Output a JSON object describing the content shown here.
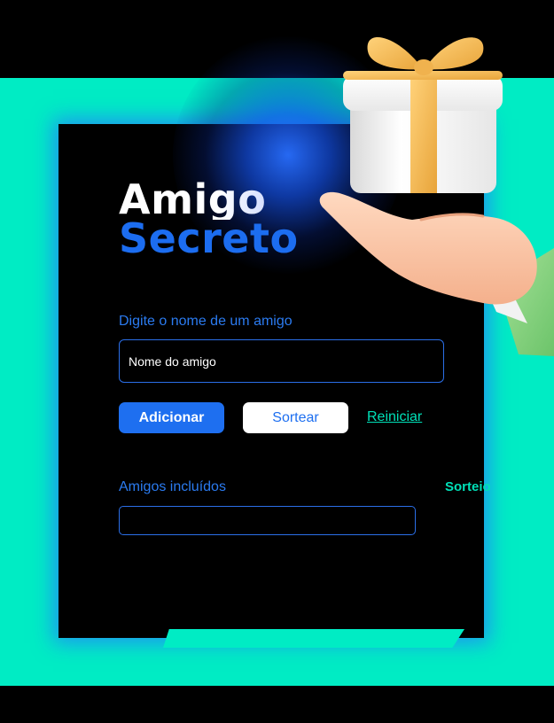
{
  "header": {
    "title_line1": "Amigo",
    "title_line2": "Secreto"
  },
  "form": {
    "name_label": "Digite o nome de um amigo",
    "name_input": {
      "value": "",
      "placeholder": "Nome do amigo"
    },
    "add_button_label": "Adicionar",
    "draw_button_label": "Sortear",
    "reset_link_label": "Reiniciar"
  },
  "results": {
    "friends_label": "Amigos incluídos",
    "draw_label": "Sorteio",
    "friends": []
  },
  "illustration": {
    "icon": "gift-on-hand-icon"
  },
  "colors": {
    "accent_blue": "#1e6ff0",
    "mint": "#00ecc4",
    "background": "#000000",
    "white": "#ffffff"
  }
}
